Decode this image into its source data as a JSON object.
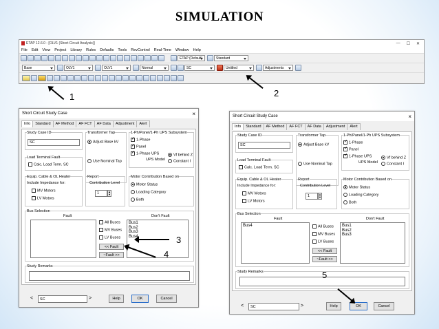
{
  "page_title": "SIMULATION",
  "etap": {
    "title": "ETAP 12.6.0 - [OLV1 (Short-Circuit Analysis)]",
    "menu": [
      "File",
      "Edit",
      "View",
      "Project",
      "Library",
      "Rules",
      "Defaults",
      "Tools",
      "RevControl",
      "Real-Time",
      "Window",
      "Help"
    ],
    "row1_dropdowns": [
      "ETAP (Default)",
      "Standard"
    ],
    "row2_dropdowns": [
      "Base",
      "OLV1",
      "OLV1",
      "Normal",
      "SC",
      "Untitled",
      "Adjustments"
    ]
  },
  "dialog": {
    "title": "Short Circuit Study Case",
    "tabs": [
      "Info",
      "Standard",
      "AF Method",
      "AF FCT",
      "AF Data",
      "Adjustment",
      "Alert"
    ],
    "study_case_id_label": "Study Case ID",
    "study_case_id": "SC",
    "transformer_tap_label": "Transformer Tap",
    "adjust_base": "Adjust Base kV",
    "use_nominal": "Use Nominal Tap",
    "ups_group_label": "1-Ph/Panel/1-Ph UPS Subsystem",
    "one_phase": "1-Phase",
    "panel": "Panel",
    "one_phase_ups": "1-Phase UPS",
    "ups_model_label": "UPS Model",
    "vf_behind_z": "Vf behind Z",
    "constant_i": "Constant I",
    "load_terminal_label": "Load Terminal Fault",
    "calc_load_term": "Calc. Load Term. SC",
    "equip_label": "Equip. Cable & OL Heater",
    "include_impedance": "Include Impedance for:",
    "mv_motors": "MV Motors",
    "lv_motors": "LV Motors",
    "report_label": "Report",
    "contribution_level": "Contribution Level",
    "contribution_value": "1",
    "motor_contrib_label": "Motor Contribution Based on",
    "motor_status": "Motor Status",
    "loading_category": "Loading Category",
    "both": "Both",
    "bus_selection_label": "Bus Selection",
    "fault_label": "Fault",
    "dont_fault_label": "Don't Fault",
    "all_buses": "All Buses",
    "mv_buses": "MV Buses",
    "lv_buses": "LV Buses",
    "fault_btn": "<< Fault",
    "unfault_btn": "~Fault >>",
    "study_remarks_label": "Study Remarks",
    "bottom_select": "SC",
    "help": "Help",
    "ok": "OK",
    "cancel": "Cancel",
    "left_fault_list": [],
    "left_dont_fault_list": [
      "Bus1",
      "Bus2",
      "Bus3",
      "Bus4"
    ],
    "right_fault_list": [
      "Bus4"
    ],
    "right_dont_fault_list": [
      "Bus1",
      "Bus2",
      "Bus3"
    ]
  },
  "annotations": [
    "1",
    "2",
    "3",
    "4",
    "5"
  ]
}
